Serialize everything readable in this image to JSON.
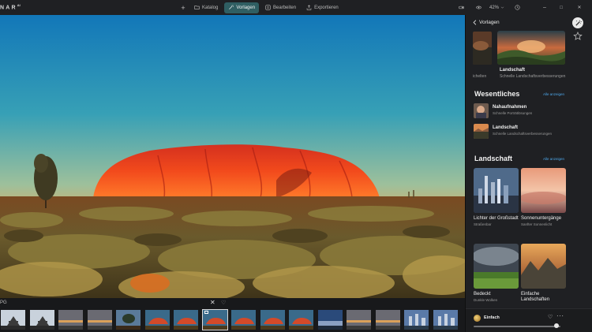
{
  "app": {
    "logo_text": "NAR",
    "logo_sup": "AI"
  },
  "topbar": {
    "add_label": "+",
    "tabs": [
      {
        "label": "Katalog",
        "icon": "folder-icon",
        "active": false
      },
      {
        "label": "Vorlagen",
        "icon": "magic-wand-icon",
        "active": true
      },
      {
        "label": "Bearbeiten",
        "icon": "sliders-icon",
        "active": false
      },
      {
        "label": "Exportieren",
        "icon": "export-icon",
        "active": false
      }
    ],
    "zoom": "42%",
    "window_controls": {
      "minimize": "–",
      "maximize": "□",
      "close": "✕"
    }
  },
  "filmstrip": {
    "file_name": "PG",
    "close_symbol": "✕",
    "heart_symbol": "♡",
    "thumbs": [
      "temple",
      "temple",
      "sunset",
      "sunset",
      "tree",
      "rock",
      "rock",
      "rock",
      "rock",
      "rock",
      "rock",
      "lake",
      "sunset",
      "sunset",
      "city",
      "city"
    ],
    "selected_index": 7
  },
  "panel": {
    "back_label": "Vorlagen",
    "featured_prev_label": "ichelten",
    "featured": {
      "title": "Landschaft",
      "subtitle": "Schnelle Landschaftsverbesserungen"
    },
    "essentials": {
      "title": "Wesentliches",
      "see_all": "Alle anzeigen",
      "items": [
        {
          "title": "Nahaufnahmen",
          "subtitle": "Schnelle Porträtlösungen"
        },
        {
          "title": "Landschaft",
          "subtitle": "Schnelle Landschaftsverbesserungen"
        }
      ]
    },
    "landscape": {
      "title": "Landschaft",
      "see_all": "Alle anzeigen",
      "cards": [
        {
          "title": "Lichter der Großstadt",
          "subtitle": "Straßenbar"
        },
        {
          "title": "Sonnenuntergänge",
          "subtitle": "Sanfter Sonnenlicht"
        },
        {
          "title": "Bedeckt",
          "subtitle": "Dunkle Wolken"
        },
        {
          "title": "Einfache Landschaften",
          "subtitle": ""
        }
      ]
    },
    "applied_preset": {
      "name": "Einfach",
      "heart": "♡",
      "more": "···",
      "amount": 0.95
    }
  }
}
